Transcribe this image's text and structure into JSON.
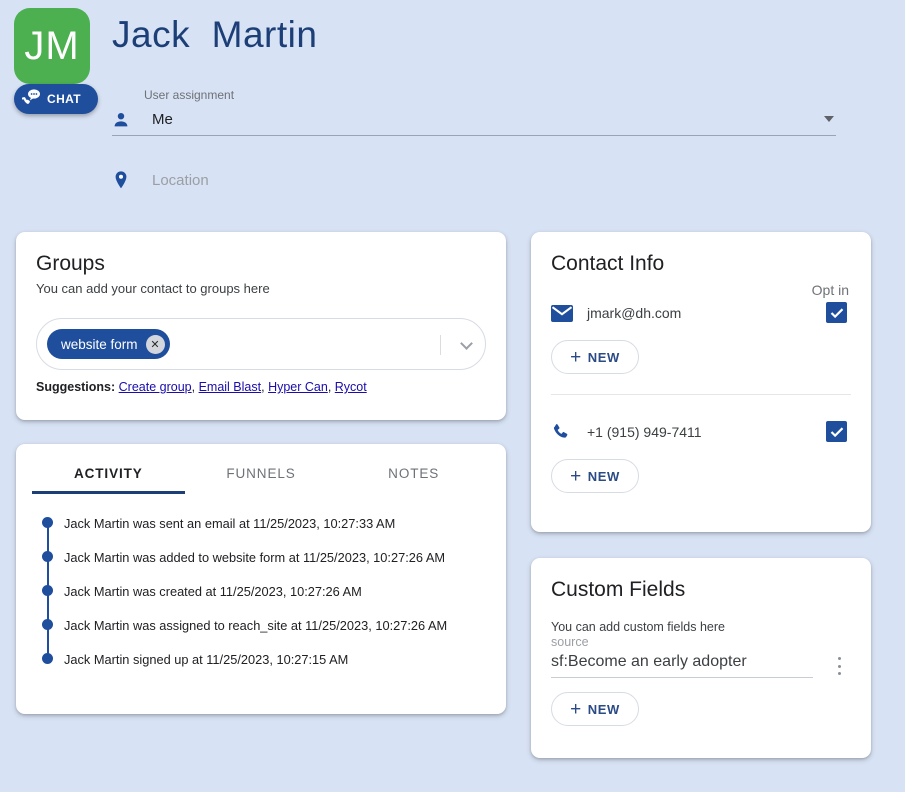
{
  "header": {
    "avatar_initials": "JM",
    "chat_badge_label": "CHAT",
    "chat_badge_icon": "phone-chat-icon",
    "contact_name": "Jack  Martin",
    "user_assignment": {
      "label": "User assignment",
      "value": "Me",
      "icon": "person-icon",
      "caret": "chevron-down-icon"
    },
    "location": {
      "placeholder": "Location",
      "icon": "map-pin-icon"
    }
  },
  "groups": {
    "title": "Groups",
    "subtitle": "You can add your contact to groups here",
    "chips": [
      {
        "label": "website form",
        "remove_label": "✕"
      }
    ],
    "suggestions_label": "Suggestions:",
    "suggestions": [
      "Create group",
      "Email Blast",
      "Hyper Can",
      "Rycot"
    ]
  },
  "activity": {
    "tabs": [
      {
        "label": "ACTIVITY",
        "active": true
      },
      {
        "label": "FUNNELS",
        "active": false
      },
      {
        "label": "NOTES",
        "active": false
      }
    ],
    "items": [
      {
        "text": "Jack Martin was sent an email at 11/25/2023, 10:27:33 AM"
      },
      {
        "text": "Jack Martin was added to website form at 11/25/2023, 10:27:26 AM"
      },
      {
        "text": "Jack Martin was created at 11/25/2023, 10:27:26 AM"
      },
      {
        "text": "Jack Martin was assigned to reach_site at 11/25/2023, 10:27:26 AM"
      },
      {
        "text": "Jack Martin signed up at 11/25/2023, 10:27:15 AM"
      }
    ]
  },
  "contact_info": {
    "title": "Contact Info",
    "optin_label": "Opt in",
    "email": {
      "value": "jmark@dh.com",
      "icon": "email-icon",
      "optin_checked": true,
      "new_button": "NEW"
    },
    "phone": {
      "value": "+1 (915) 949-7411",
      "icon": "phone-icon",
      "optin_checked": true,
      "new_button": "NEW"
    }
  },
  "custom_fields": {
    "title": "Custom Fields",
    "subtitle": "You can add custom fields here",
    "field_label": "source",
    "field_value": "sf:Become an early adopter",
    "menu_icon": "kebab-menu-icon",
    "new_button": "NEW"
  },
  "colors": {
    "page_background": "#d7e2f4",
    "brand_blue": "#1f4e9c",
    "title_blue": "#1c3f77",
    "avatar_green": "#4caf50",
    "link_blue": "#1a0dab"
  }
}
